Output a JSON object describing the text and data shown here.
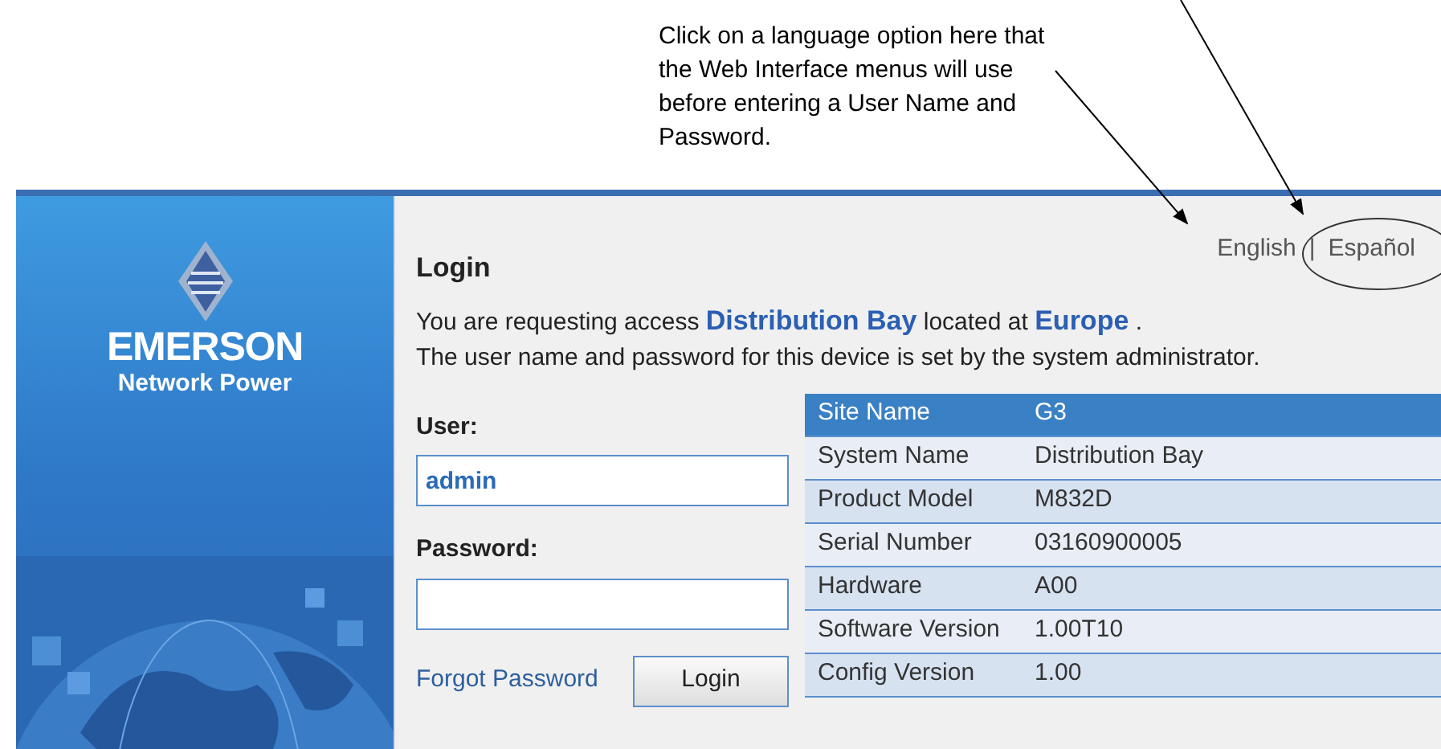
{
  "callout": {
    "text": "Click on a language option here that the Web Interface menus will use before entering a User Name and Password."
  },
  "brand": {
    "name": "EMERSON",
    "tagline": "Network Power"
  },
  "login": {
    "title": "Login",
    "languages": [
      {
        "label": "English"
      },
      {
        "label": "Español"
      }
    ],
    "separator": "|",
    "access_text": "You are requesting access **Distribution Bay** located at **Europe** .",
    "admin_note": "The user name and password for this device is set by the system administrator.",
    "user": {
      "label": "User:",
      "value": "admin"
    },
    "password": {
      "label": "Password:"
    },
    "forgot_link": "Forgot Password",
    "login_button": "Login"
  },
  "info_table": {
    "rows": [
      {
        "label": "Site Name",
        "value": "G3"
      },
      {
        "label": "System Name",
        "value": "Distribution Bay"
      },
      {
        "label": "Product Model",
        "value": "M832D"
      },
      {
        "label": "Serial Number",
        "value": "03160900005"
      },
      {
        "label": "Hardware",
        "value": "A00"
      },
      {
        "label": "Software Version",
        "value": "1.00T10"
      },
      {
        "label": "Config Version",
        "value": "1.00"
      }
    ]
  }
}
